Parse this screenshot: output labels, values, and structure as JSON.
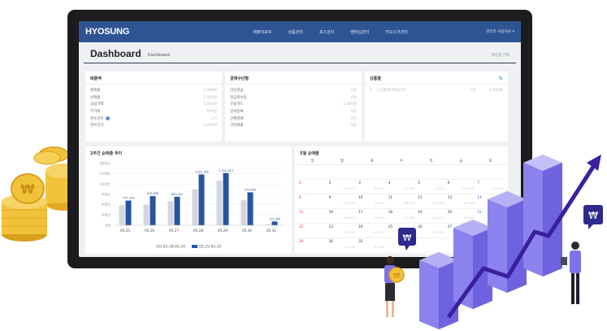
{
  "app": {
    "brand": "HYOSUNG",
    "menu": [
      "매출리포트",
      "상품관리",
      "포스관리",
      "멤버십관리",
      "키오스크관리"
    ],
    "user": "관리자 사용자님"
  },
  "titlebar": {
    "title": "Dashboard",
    "subtitle": "Dashboard",
    "right": "매장명 선택"
  },
  "sales_card": {
    "title": "매출액",
    "rows": [
      {
        "label": "총매출",
        "value": "1,000원"
      },
      {
        "label": "순매출",
        "value": "1,000원"
      },
      {
        "label": "공급가액",
        "value": "1,000원"
      },
      {
        "label": "부가세",
        "value": "100원"
      },
      {
        "label": "영수건수",
        "value": "1건"
      },
      {
        "label": "영수단가",
        "value": "1,000원"
      }
    ]
  },
  "payment_card": {
    "title": "결제수단별",
    "rows": [
      {
        "label": "단순현금",
        "value": "0원"
      },
      {
        "label": "현금영수증",
        "value": "0원"
      },
      {
        "label": "신용카드",
        "value": "1,000원"
      },
      {
        "label": "임의등록",
        "value": "0원"
      },
      {
        "label": "간편결제",
        "value": "0원"
      },
      {
        "label": "기타매출",
        "value": "0원"
      }
    ]
  },
  "product_card": {
    "title": "상품별",
    "rows": [
      {
        "rank": "1",
        "name": "1.상품명(카테고리)",
        "qty": "1개",
        "value": "1,000원"
      }
    ]
  },
  "trend_card": {
    "title": "2주간 순매출 추이",
    "legend": [
      "05.18-05.24",
      "05.25-05.31"
    ]
  },
  "calendar_card": {
    "title": "5월 순매출",
    "weekdays": [
      "일",
      "월",
      "화",
      "수",
      "목",
      "금",
      "토"
    ],
    "days": [
      {
        "d": "",
        "a": ""
      },
      {
        "d": "",
        "a": ""
      },
      {
        "d": "",
        "a": ""
      },
      {
        "d": "",
        "a": ""
      },
      {
        "d": "",
        "a": ""
      },
      {
        "d": "",
        "a": ""
      },
      {
        "d": "",
        "a": ""
      },
      {
        "d": "1",
        "a": ""
      },
      {
        "d": "2",
        "a": "196,000"
      },
      {
        "d": "3",
        "a": "84,000"
      },
      {
        "d": "4",
        "a": "61,770"
      },
      {
        "d": "5",
        "a": "73,200"
      },
      {
        "d": "6",
        "a": "113,000"
      },
      {
        "d": "7",
        "a": "146,000"
      },
      {
        "d": "8",
        "a": ""
      },
      {
        "d": "9",
        "a": "150,772"
      },
      {
        "d": "10",
        "a": "79,600"
      },
      {
        "d": "11",
        "a": "88,273"
      },
      {
        "d": "12",
        "a": "111,660"
      },
      {
        "d": "13",
        "a": "69,000"
      },
      {
        "d": "14",
        "a": "171,180"
      },
      {
        "d": "15",
        "a": ""
      },
      {
        "d": "16",
        "a": "186,000"
      },
      {
        "d": "17",
        "a": "76,070"
      },
      {
        "d": "18",
        "a": "77,000"
      },
      {
        "d": "19",
        "a": "163,000"
      },
      {
        "d": "20",
        "a": "76,800"
      },
      {
        "d": "21",
        "a": "135,000"
      },
      {
        "d": "22",
        "a": ""
      },
      {
        "d": "23",
        "a": "101,000"
      },
      {
        "d": "24",
        "a": "113,570"
      },
      {
        "d": "25",
        "a": "39,100"
      },
      {
        "d": "26",
        "a": "136,000"
      },
      {
        "d": "27",
        "a": "62,600"
      },
      {
        "d": "28",
        "a": "112,000"
      },
      {
        "d": "29",
        "a": ""
      },
      {
        "d": "30",
        "a": "87,430"
      },
      {
        "d": "31",
        "a": "67,500"
      },
      {
        "d": "",
        "a": ""
      },
      {
        "d": "",
        "a": ""
      },
      {
        "d": "",
        "a": ""
      },
      {
        "d": "",
        "a": ""
      }
    ]
  },
  "chart_data": {
    "type": "bar",
    "title": "2주간 순매출 추이",
    "categories": [
      "05.25",
      "05.26",
      "05.27",
      "05.28",
      "05.29",
      "05.30",
      "05.31"
    ],
    "ylim": [
      0,
      1800000
    ],
    "yticks": [
      "0원",
      "300만",
      "600만",
      "900만",
      "1200만",
      "1500만",
      "1800만"
    ],
    "series": [
      {
        "name": "05.18-05.24",
        "color": "#d3d6de",
        "values": [
          580000,
          600000,
          700000,
          1050000,
          1300000,
          730000,
          30000
        ]
      },
      {
        "name": "05.25-05.31",
        "color": "#27559e",
        "values": [
          720000,
          850000,
          830000,
          1480000,
          1520000,
          960000,
          110000
        ]
      }
    ],
    "data_labels": [
      "727,316",
      "874,658",
      "831,221",
      "1,521,766",
      "1,551,443",
      "979,863",
      "112,365"
    ]
  },
  "colors": {
    "nav": "#2f5494",
    "accent_dark": "#27559e",
    "accent_light": "#d3d6de",
    "purple": "#7d72e8",
    "coin": "#f2c23a"
  }
}
